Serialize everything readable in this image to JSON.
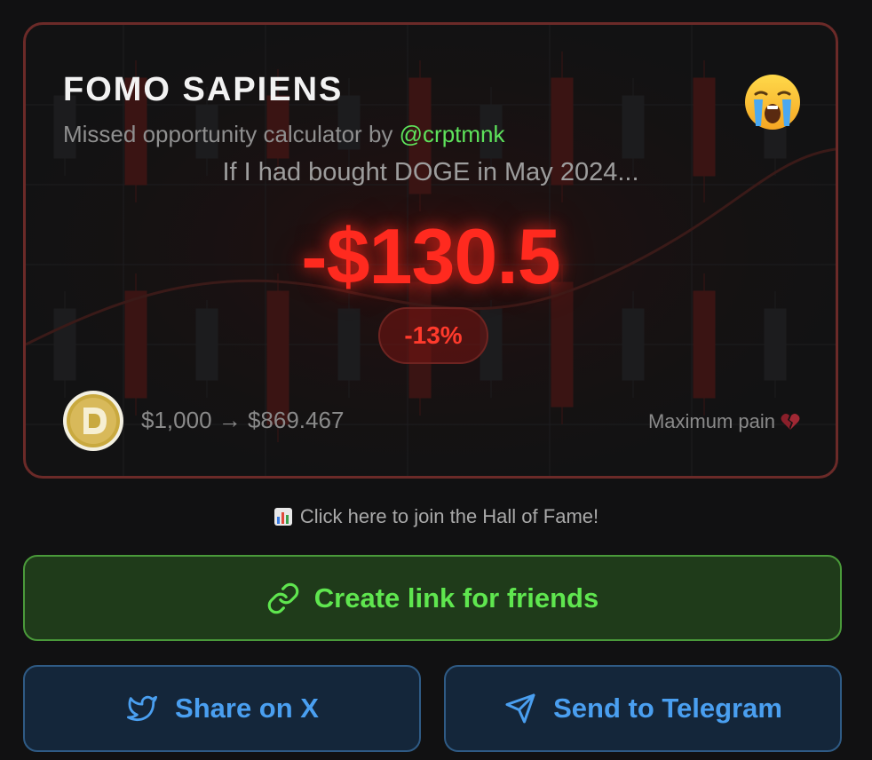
{
  "card": {
    "title": "FOMO SAPIENS",
    "subtitle_prefix": "Missed opportunity calculator by",
    "handle": "@crptmnk",
    "question": "If I had bought DOGE in May 2024...",
    "amount": "-$130.5",
    "percent": "-13%",
    "conversion": "$1,000 → $869.467",
    "pain_label": "Maximum pain",
    "coin_icon": "doge-coin-icon",
    "mood_icon": "crying-face-icon"
  },
  "hall_of_fame": {
    "label": "Click here to join the Hall of Fame!",
    "icon": "bar-chart-icon"
  },
  "actions": {
    "create_link": "Create link for friends",
    "share_x": "Share on X",
    "send_telegram": "Send to Telegram"
  },
  "colors": {
    "loss_red": "#ff2a1f",
    "accent_green": "#5fe64f",
    "accent_blue": "#4a9ff0",
    "card_border": "#6b2a28"
  }
}
